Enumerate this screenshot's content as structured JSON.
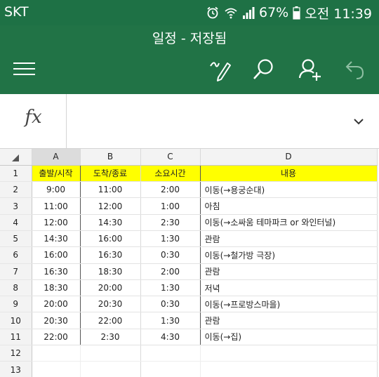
{
  "status_bar": {
    "carrier": "SKT",
    "battery": "67%",
    "time": "오전 11:39",
    "icons": [
      "alarm-icon",
      "wifi-icon",
      "signal-icon",
      "battery-icon"
    ]
  },
  "app_bar": {
    "title": "일정 - 저장됨",
    "icons": [
      "menu-icon",
      "draw-icon",
      "search-icon",
      "share-person-icon",
      "undo-icon"
    ]
  },
  "formula_bar": {
    "fx_label": "fx",
    "value": ""
  },
  "sheet": {
    "corner": "◢",
    "columns": [
      "A",
      "B",
      "C",
      "D"
    ],
    "selected_column": "A",
    "rows": [
      {
        "num": "1",
        "cells": [
          "출발/시작",
          "도착/종료",
          "소요시간",
          "내용"
        ]
      },
      {
        "num": "2",
        "cells": [
          "9:00",
          "11:00",
          "2:00",
          "이동(→용궁순대)"
        ]
      },
      {
        "num": "3",
        "cells": [
          "11:00",
          "12:00",
          "1:00",
          "아침"
        ]
      },
      {
        "num": "4",
        "cells": [
          "12:00",
          "14:30",
          "2:30",
          "이동(→소싸움 테마파크 or 와인터널)"
        ]
      },
      {
        "num": "5",
        "cells": [
          "14:30",
          "16:00",
          "1:30",
          "관람"
        ]
      },
      {
        "num": "6",
        "cells": [
          "16:00",
          "16:30",
          "0:30",
          "이동(→철가방 극장)"
        ]
      },
      {
        "num": "7",
        "cells": [
          "16:30",
          "18:30",
          "2:00",
          "관람"
        ]
      },
      {
        "num": "8",
        "cells": [
          "18:30",
          "20:00",
          "1:30",
          "저녁"
        ]
      },
      {
        "num": "9",
        "cells": [
          "20:00",
          "20:30",
          "0:30",
          "이동(→프로방스마을)"
        ]
      },
      {
        "num": "10",
        "cells": [
          "20:30",
          "22:00",
          "1:30",
          "관람"
        ]
      },
      {
        "num": "11",
        "cells": [
          "22:00",
          "2:30",
          "4:30",
          "이동(→집)"
        ]
      },
      {
        "num": "12",
        "cells": [
          "",
          "",
          "",
          ""
        ]
      },
      {
        "num": "13",
        "cells": [
          "",
          "",
          "",
          ""
        ]
      }
    ]
  },
  "colors": {
    "status_bar": "#1e7145",
    "app_bar": "#217346",
    "header_fill": "#ffff00"
  }
}
